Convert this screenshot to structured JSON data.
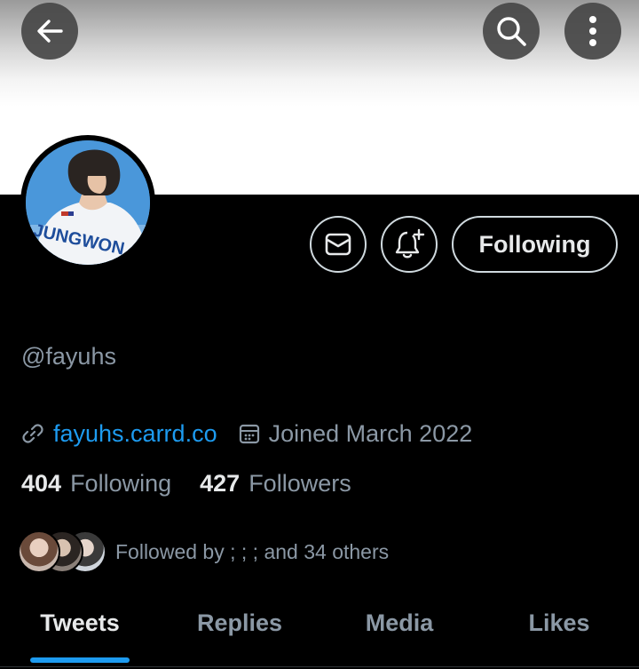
{
  "header": {
    "back_icon": "arrow-left-icon",
    "search_icon": "search-icon",
    "more_icon": "more-vertical-icon"
  },
  "profile": {
    "avatar_jersey_text": "JUNGWON",
    "handle": "@fayuhs",
    "website": "fayuhs.carrd.co",
    "joined": "Joined March 2022",
    "following_count": "404",
    "following_label": "Following",
    "followers_count": "427",
    "followers_label": "Followers",
    "followed_by": "Followed by ; ; ; and 34 others"
  },
  "actions": {
    "message_icon": "mail-icon",
    "notify_icon": "bell-plus-icon",
    "following_button": "Following"
  },
  "tabs": [
    {
      "label": "Tweets",
      "active": true
    },
    {
      "label": "Replies",
      "active": false
    },
    {
      "label": "Media",
      "active": false
    },
    {
      "label": "Likes",
      "active": false
    }
  ],
  "colors": {
    "background": "#000000",
    "accent": "#1d9bf0",
    "muted_text": "#8b98a5",
    "primary_text": "#e7e9ea"
  }
}
